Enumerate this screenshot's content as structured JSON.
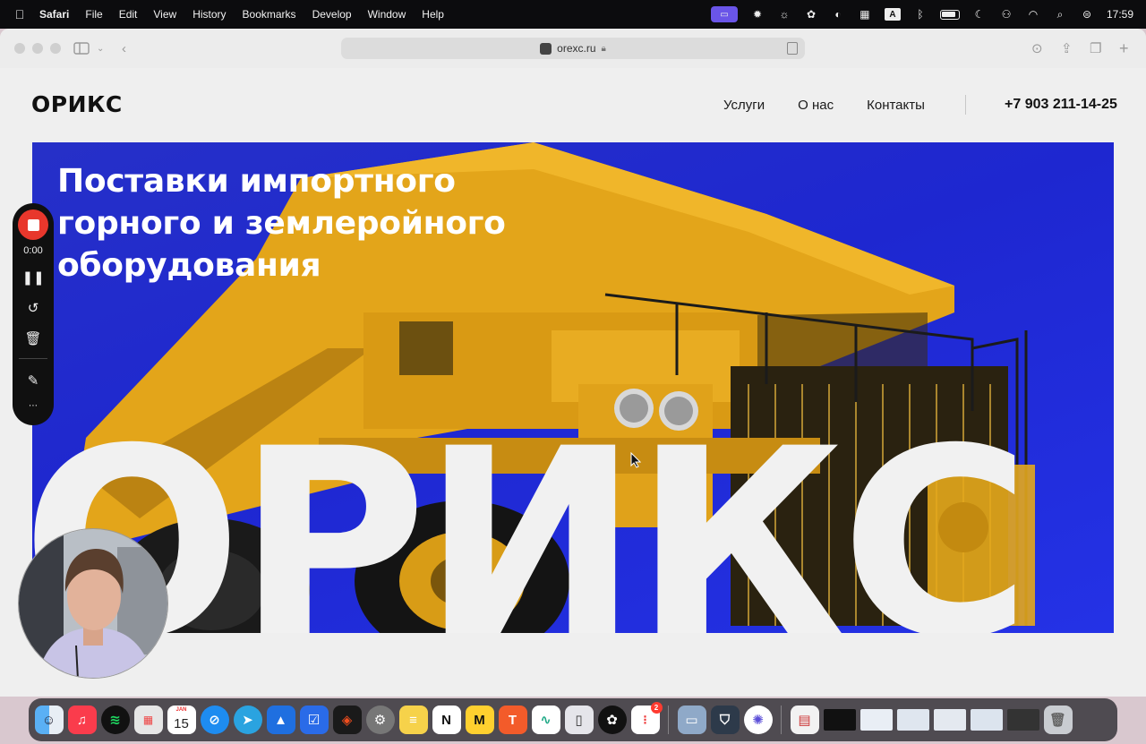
{
  "menubar": {
    "app_name": "Safari",
    "items": [
      "File",
      "Edit",
      "View",
      "History",
      "Bookmarks",
      "Develop",
      "Window",
      "Help"
    ],
    "input_indicator": "A",
    "clock": "17:59"
  },
  "browser": {
    "url": "orexc.ru"
  },
  "site": {
    "logo": "ОРИКС",
    "nav": [
      "Услуги",
      "О нас",
      "Контакты"
    ],
    "phone": "+7 903 211-14-25",
    "hero_title_lines": [
      "Поставки импортного",
      "горного и землеройного",
      "оборудования"
    ],
    "hero_big_word": "ОРИКС",
    "hero_bg_color": "#2130d4",
    "truck_color": "#e3a51a"
  },
  "recorder": {
    "time": "0:00",
    "stop_color": "#e8372c"
  },
  "dock": {
    "calendar_month": "JAN",
    "calendar_day": "15",
    "reminders_badge": "2",
    "apps": [
      "finder",
      "music",
      "spotify",
      "launchpad",
      "calendar",
      "safari",
      "telegram",
      "testflight",
      "tasks",
      "figma",
      "system-settings",
      "notes",
      "notion",
      "miro",
      "typora",
      "freeform",
      "iphone-mirroring",
      "chatgpt",
      "reminders",
      "preview",
      "shield-app",
      "perplexity"
    ]
  }
}
